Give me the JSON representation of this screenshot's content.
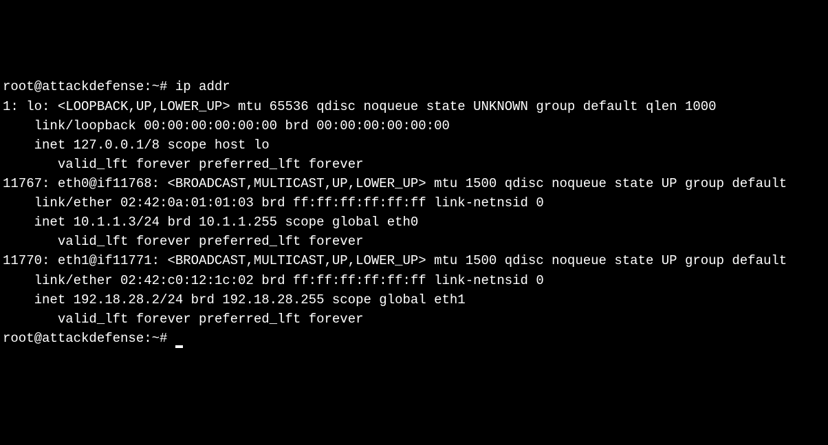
{
  "terminal": {
    "prompt1": "root@attackdefense:~# ",
    "command1": "ip addr",
    "output": [
      "1: lo: <LOOPBACK,UP,LOWER_UP> mtu 65536 qdisc noqueue state UNKNOWN group default qlen 1000",
      "    link/loopback 00:00:00:00:00:00 brd 00:00:00:00:00:00",
      "    inet 127.0.0.1/8 scope host lo",
      "       valid_lft forever preferred_lft forever",
      "11767: eth0@if11768: <BROADCAST,MULTICAST,UP,LOWER_UP> mtu 1500 qdisc noqueue state UP group default ",
      "    link/ether 02:42:0a:01:01:03 brd ff:ff:ff:ff:ff:ff link-netnsid 0",
      "    inet 10.1.1.3/24 brd 10.1.1.255 scope global eth0",
      "       valid_lft forever preferred_lft forever",
      "11770: eth1@if11771: <BROADCAST,MULTICAST,UP,LOWER_UP> mtu 1500 qdisc noqueue state UP group default ",
      "    link/ether 02:42:c0:12:1c:02 brd ff:ff:ff:ff:ff:ff link-netnsid 0",
      "    inet 192.18.28.2/24 brd 192.18.28.255 scope global eth1",
      "       valid_lft forever preferred_lft forever"
    ],
    "prompt2": "root@attackdefense:~# "
  }
}
